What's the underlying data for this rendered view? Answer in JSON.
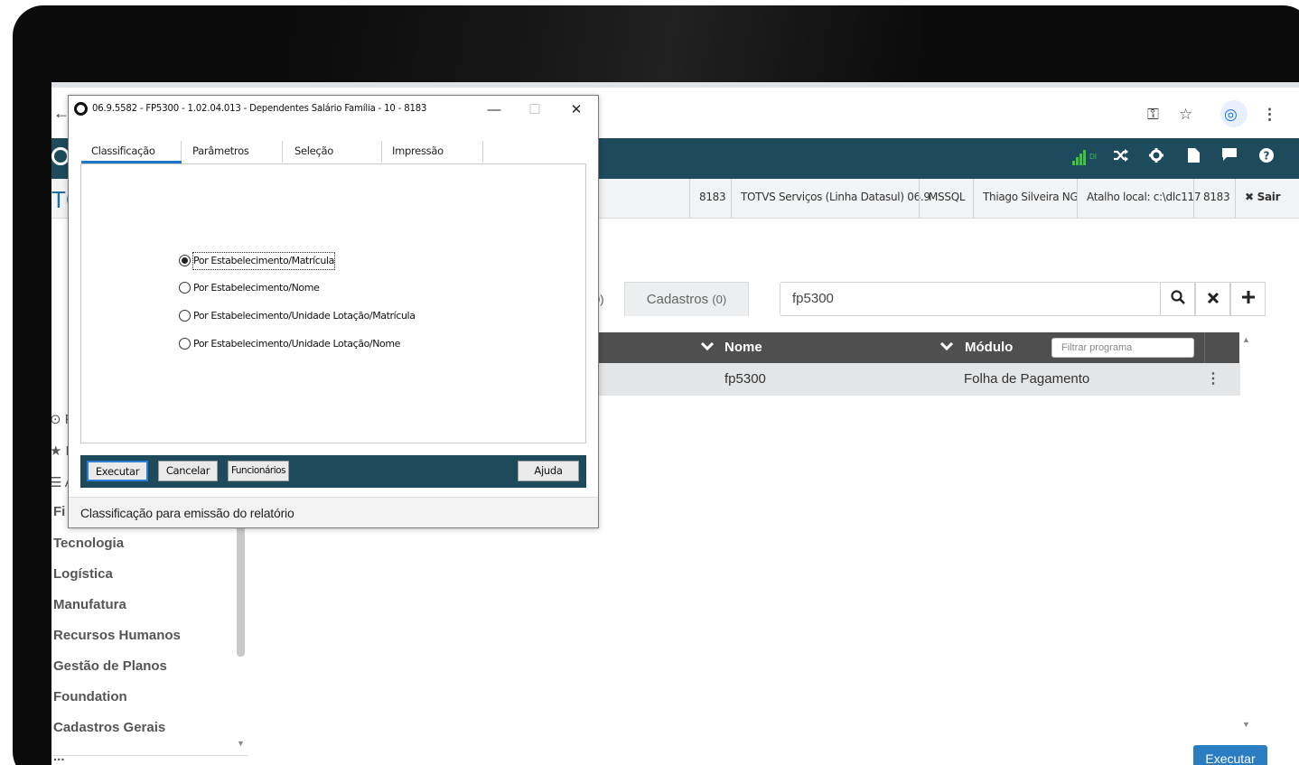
{
  "browser": {
    "back": "←",
    "key_icon": "⚿",
    "star_icon": "☆",
    "profile_icon": "◎",
    "menu_icon": "⋮"
  },
  "header": {
    "signal_text": "DI",
    "icons": [
      "shuffle-icon",
      "gear-icon",
      "document-icon",
      "chat-icon",
      "help-icon"
    ]
  },
  "info_strip": {
    "left_title": "TC",
    "cells": [
      "8183",
      "TOTVS Serviços (Linha Datasul) 06.9",
      "MSSQL",
      "Thiago Silveira NG",
      "Atalho local: c:\\dlc117",
      "8183"
    ],
    "logout": "✖ Sair"
  },
  "tabs": {
    "partial": "0)",
    "cadastros_label": "Cadastros",
    "cadastros_count": "(0)"
  },
  "search": {
    "value": "fp5300"
  },
  "table": {
    "columns": [
      "Nome",
      "Módulo"
    ],
    "filter_placeholder": "Filtrar programa",
    "rows": [
      {
        "nome": "fp5300",
        "modulo": "Folha de Pagamento"
      }
    ]
  },
  "execute_button": "Executar",
  "sidebar": {
    "mini": [
      "⊙ F",
      "★ F",
      "☰ A"
    ],
    "partial_first": "Fi",
    "items": [
      "Tecnologia",
      "Logística",
      "Manufatura",
      "Recursos Humanos",
      "Gestão de Planos",
      "Foundation",
      "Cadastros Gerais",
      "..."
    ]
  },
  "dialog": {
    "title": "06.9.5582 - FP5300 - 1.02.04.013 - Dependentes Salário Família - 10 - 8183",
    "minimize": "—",
    "maximize": "☐",
    "close": "✕",
    "tabs": [
      "Classificação",
      "Parâmetros",
      "Seleção",
      "Impressão"
    ],
    "options": [
      {
        "label": "Por Estabelecimento/Matrícula",
        "checked": true
      },
      {
        "label": "Por Estabelecimento/Nome",
        "checked": false
      },
      {
        "label": "Por Estabelecimento/Unidade Lotação/Matrícula",
        "checked": false
      },
      {
        "label": "Por Estabelecimento/Unidade Lotação/Nome",
        "checked": false
      }
    ],
    "buttons": {
      "executar": "Executar",
      "cancelar": "Cancelar",
      "funcionarios": "Funcionários",
      "ajuda": "Ajuda"
    },
    "status": "Classificação para emissão do relatório"
  },
  "colors": {
    "header_bg": "#1d4b5c",
    "table_header_bg": "#4f4f4f",
    "accent_blue": "#1e74c6",
    "brand_title": "#1e6e9e"
  }
}
